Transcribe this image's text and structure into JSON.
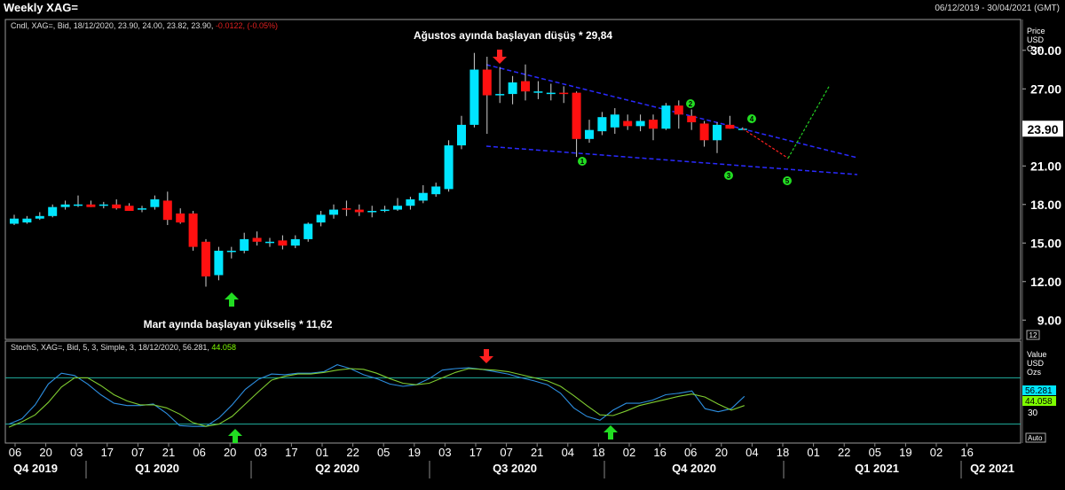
{
  "header": {
    "title": "Weekly XAG=",
    "date_range": "06/12/2019 - 30/04/2021 (GMT)"
  },
  "price_info": {
    "text": "Cndl, XAG=, Bid, 18/12/2020, 23.90, 24.00, 23.82, 23.90,",
    "change": "-0.0122, (-0.05%)"
  },
  "stoch_info": {
    "text": "StochS, XAG=, Bid,  5, 3, Simple, 3, 18/12/2020, 56.281,",
    "d_value": "44.058"
  },
  "price_axis": {
    "title_lines": [
      "Price",
      "USD",
      "Ozs"
    ],
    "last_price": "23.90",
    "badge": "12"
  },
  "stoch_axis": {
    "title_lines": [
      "Value",
      "USD",
      "Ozs"
    ],
    "k_value": "56.281",
    "d_value": "44.058",
    "tick30": "30",
    "auto_label": "Auto"
  },
  "annotations": {
    "top": "Ağustos ayında başlayan düşüş * 29,84",
    "bottom": "Mart ayında başlayan yükseliş * 11,62",
    "wave_labels": [
      "1",
      "2",
      "3",
      "4",
      "5"
    ]
  },
  "colors": {
    "up": "#00e5ff",
    "down": "#ff1010",
    "trend": "#2a2aff",
    "forecast_down": "#ff2020",
    "forecast_up": "#22cc22",
    "wave": "#22dd22",
    "stoch_k": "#2c8ee0",
    "stoch_d": "#7fcc30",
    "arrow_up": "#22dd22",
    "arrow_down": "#ff2020",
    "band": "#20b0a0"
  },
  "chart_data": [
    {
      "type": "candlestick",
      "title": "Weekly XAG=",
      "ylabel": "Price USD Ozs",
      "ylim": [
        7.5,
        32.4
      ],
      "yticks": [
        9,
        12,
        15,
        18,
        21,
        24,
        27,
        30
      ],
      "x_labels": [
        "06",
        "20",
        "03",
        "17",
        "07",
        "21",
        "06",
        "20",
        "03",
        "17",
        "01",
        "22",
        "05",
        "19",
        "03",
        "17",
        "07",
        "21",
        "04",
        "18",
        "02",
        "16",
        "06",
        "20",
        "04",
        "18",
        "01",
        "22",
        "05",
        "19",
        "02",
        "16"
      ],
      "quarter_labels": [
        "Q4 2019",
        "Q1 2020",
        "Q2 2020",
        "Q3 2020",
        "Q4 2020",
        "Q1 2021",
        "Q2 2021"
      ],
      "candles": [
        {
          "o": 16.5,
          "h": 17.2,
          "l": 16.4,
          "c": 16.9
        },
        {
          "o": 16.6,
          "h": 17.1,
          "l": 16.5,
          "c": 16.9
        },
        {
          "o": 16.9,
          "h": 17.4,
          "l": 16.8,
          "c": 17.1
        },
        {
          "o": 17.1,
          "h": 18.0,
          "l": 17.0,
          "c": 17.8
        },
        {
          "o": 17.8,
          "h": 18.3,
          "l": 17.6,
          "c": 18.0
        },
        {
          "o": 18.0,
          "h": 18.7,
          "l": 17.8,
          "c": 18.0
        },
        {
          "o": 18.0,
          "h": 18.3,
          "l": 17.8,
          "c": 17.8
        },
        {
          "o": 17.9,
          "h": 18.2,
          "l": 17.7,
          "c": 18.0
        },
        {
          "o": 18.0,
          "h": 18.4,
          "l": 17.6,
          "c": 17.7
        },
        {
          "o": 17.9,
          "h": 18.1,
          "l": 17.5,
          "c": 17.5
        },
        {
          "o": 17.6,
          "h": 17.9,
          "l": 17.4,
          "c": 17.7
        },
        {
          "o": 17.8,
          "h": 18.7,
          "l": 17.6,
          "c": 18.4
        },
        {
          "o": 18.3,
          "h": 19.0,
          "l": 16.4,
          "c": 16.8
        },
        {
          "o": 17.3,
          "h": 17.7,
          "l": 16.5,
          "c": 16.6
        },
        {
          "o": 17.3,
          "h": 17.5,
          "l": 14.4,
          "c": 14.7
        },
        {
          "o": 15.1,
          "h": 15.3,
          "l": 11.6,
          "c": 12.4
        },
        {
          "o": 12.5,
          "h": 14.7,
          "l": 12.1,
          "c": 14.4
        },
        {
          "o": 14.4,
          "h": 14.7,
          "l": 13.8,
          "c": 14.4
        },
        {
          "o": 14.4,
          "h": 15.8,
          "l": 14.2,
          "c": 15.3
        },
        {
          "o": 15.4,
          "h": 15.9,
          "l": 14.8,
          "c": 15.1
        },
        {
          "o": 15.1,
          "h": 15.4,
          "l": 14.7,
          "c": 15.1
        },
        {
          "o": 15.2,
          "h": 15.6,
          "l": 14.5,
          "c": 14.8
        },
        {
          "o": 14.8,
          "h": 15.6,
          "l": 14.6,
          "c": 15.3
        },
        {
          "o": 15.3,
          "h": 16.6,
          "l": 15.1,
          "c": 16.5
        },
        {
          "o": 16.6,
          "h": 17.5,
          "l": 16.3,
          "c": 17.2
        },
        {
          "o": 17.2,
          "h": 18.0,
          "l": 16.9,
          "c": 17.6
        },
        {
          "o": 17.7,
          "h": 18.3,
          "l": 17.1,
          "c": 17.6
        },
        {
          "o": 17.6,
          "h": 18.0,
          "l": 17.1,
          "c": 17.4
        },
        {
          "o": 17.4,
          "h": 17.9,
          "l": 17.0,
          "c": 17.5
        },
        {
          "o": 17.5,
          "h": 17.9,
          "l": 17.4,
          "c": 17.6
        },
        {
          "o": 17.6,
          "h": 18.5,
          "l": 17.5,
          "c": 17.9
        },
        {
          "o": 17.9,
          "h": 18.6,
          "l": 17.6,
          "c": 18.4
        },
        {
          "o": 18.3,
          "h": 19.5,
          "l": 18.1,
          "c": 18.9
        },
        {
          "o": 18.8,
          "h": 19.7,
          "l": 18.6,
          "c": 19.4
        },
        {
          "o": 19.2,
          "h": 23.0,
          "l": 19.0,
          "c": 22.6
        },
        {
          "o": 22.6,
          "h": 24.9,
          "l": 22.3,
          "c": 24.2
        },
        {
          "o": 24.2,
          "h": 29.8,
          "l": 24.0,
          "c": 28.5
        },
        {
          "o": 28.5,
          "h": 29.5,
          "l": 23.5,
          "c": 26.5
        },
        {
          "o": 26.5,
          "h": 28.7,
          "l": 25.9,
          "c": 26.6
        },
        {
          "o": 26.6,
          "h": 28.0,
          "l": 25.8,
          "c": 27.5
        },
        {
          "o": 27.6,
          "h": 28.9,
          "l": 26.1,
          "c": 26.8
        },
        {
          "o": 26.8,
          "h": 27.6,
          "l": 26.2,
          "c": 26.8
        },
        {
          "o": 26.6,
          "h": 27.4,
          "l": 26.1,
          "c": 26.7
        },
        {
          "o": 26.7,
          "h": 27.2,
          "l": 25.9,
          "c": 26.6
        },
        {
          "o": 26.7,
          "h": 26.8,
          "l": 21.7,
          "c": 23.1
        },
        {
          "o": 23.1,
          "h": 24.6,
          "l": 22.8,
          "c": 23.8
        },
        {
          "o": 23.7,
          "h": 25.2,
          "l": 23.4,
          "c": 24.8
        },
        {
          "o": 24.0,
          "h": 25.5,
          "l": 23.5,
          "c": 25.0
        },
        {
          "o": 24.5,
          "h": 25.0,
          "l": 23.8,
          "c": 24.1
        },
        {
          "o": 24.1,
          "h": 25.0,
          "l": 23.7,
          "c": 24.5
        },
        {
          "o": 24.6,
          "h": 25.0,
          "l": 23.0,
          "c": 23.9
        },
        {
          "o": 23.9,
          "h": 25.9,
          "l": 23.8,
          "c": 25.7
        },
        {
          "o": 25.7,
          "h": 26.1,
          "l": 23.9,
          "c": 25.0
        },
        {
          "o": 24.9,
          "h": 25.4,
          "l": 23.8,
          "c": 24.4
        },
        {
          "o": 24.3,
          "h": 24.5,
          "l": 22.5,
          "c": 23.0
        },
        {
          "o": 23.0,
          "h": 24.4,
          "l": 22.0,
          "c": 24.2
        },
        {
          "o": 24.2,
          "h": 24.9,
          "l": 23.9,
          "c": 23.9
        },
        {
          "o": 23.9,
          "h": 24.0,
          "l": 23.82,
          "c": 23.9
        }
      ]
    },
    {
      "type": "line",
      "title": "StochS, XAG=, Bid, 5, 3, Simple, 3",
      "ylim": [
        0,
        100
      ],
      "band": [
        20,
        80
      ],
      "series": [
        {
          "name": "%K",
          "values": [
            20,
            27,
            45,
            72,
            86,
            83,
            72,
            58,
            47,
            44,
            44,
            46,
            34,
            18,
            17,
            17,
            28,
            45,
            65,
            78,
            85,
            84,
            86,
            86,
            88,
            97,
            92,
            84,
            79,
            72,
            69,
            71,
            79,
            90,
            92,
            93,
            91,
            88,
            85,
            80,
            76,
            71,
            60,
            41,
            30,
            25,
            38,
            47,
            47,
            51,
            58,
            60,
            63,
            40,
            36,
            40,
            56
          ]
        },
        {
          "name": "%D",
          "values": [
            16,
            23,
            32,
            48,
            68,
            80,
            80,
            70,
            58,
            50,
            45,
            45,
            41,
            33,
            22,
            17,
            20,
            30,
            46,
            62,
            77,
            82,
            85,
            85,
            87,
            90,
            92,
            91,
            86,
            79,
            73,
            71,
            73,
            80,
            87,
            92,
            91,
            90,
            88,
            84,
            80,
            76,
            69,
            57,
            44,
            32,
            31,
            37,
            44,
            48,
            52,
            56,
            59,
            55,
            46,
            38,
            44
          ]
        }
      ]
    }
  ]
}
